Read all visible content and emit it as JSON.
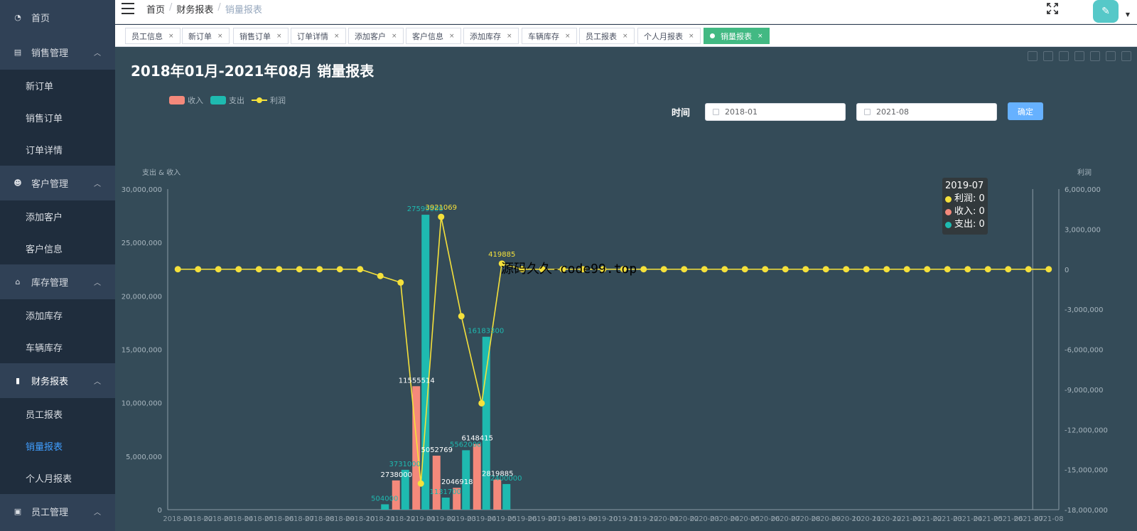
{
  "sidebar": {
    "home": "首页",
    "groups": [
      {
        "label": "销售管理",
        "items": [
          "新订单",
          "销售订单",
          "订单详情"
        ]
      },
      {
        "label": "客户管理",
        "items": [
          "添加客户",
          "客户信息"
        ]
      },
      {
        "label": "库存管理",
        "items": [
          "添加库存",
          "车辆库存"
        ]
      },
      {
        "label": "财务报表",
        "items": [
          "员工报表",
          "销量报表",
          "个人月报表"
        ],
        "active_item": "销量报表"
      },
      {
        "label": "员工管理",
        "items": []
      }
    ]
  },
  "header": {
    "breadcrumb": [
      "首页",
      "财务报表",
      "销量报表"
    ]
  },
  "tags": [
    {
      "label": "员工信息"
    },
    {
      "label": "新订单"
    },
    {
      "label": "销售订单"
    },
    {
      "label": "订单详情"
    },
    {
      "label": "添加客户"
    },
    {
      "label": "客户信息"
    },
    {
      "label": "添加库存"
    },
    {
      "label": "车辆库存"
    },
    {
      "label": "员工报表"
    },
    {
      "label": "个人月报表"
    },
    {
      "label": "销量报表",
      "active": true
    }
  ],
  "tag_close": "×",
  "page": {
    "title": "2018年01月-2021年08月 销量报表",
    "filter_label": "时间",
    "start_date": "2018-01",
    "end_date": "2021-08",
    "confirm_label": "确定",
    "watermark": "源码久久-code99.top"
  },
  "tooltip": {
    "title": "2019-07",
    "rows": [
      {
        "label": "利润: 0",
        "color": "#f5e13b"
      },
      {
        "label": "收入: 0",
        "color": "#f4897b"
      },
      {
        "label": "支出: 0",
        "color": "#1ebab0"
      }
    ]
  },
  "chart_data": {
    "type": "bar",
    "legend": [
      "收入",
      "支出",
      "利润"
    ],
    "legend_position": "top-left",
    "colors": {
      "收入": "#f4897b",
      "支出": "#1ebab0",
      "利润": "#f5e13b"
    },
    "ylabel_left": "支出 & 收入",
    "ylabel_right": "利润",
    "ylim_left": [
      0,
      30000000
    ],
    "ylim_right": [
      -18000000,
      6000000
    ],
    "yticks_left": [
      "0",
      "5,000,000",
      "10,000,000",
      "15,000,000",
      "20,000,000",
      "25,000,000",
      "30,000,000"
    ],
    "yticks_right": [
      "-18,000,000",
      "-15,000,000",
      "-12,000,000",
      "-9,000,000",
      "-6,000,000",
      "-3,000,000",
      "0",
      "3,000,000",
      "6,000,000"
    ],
    "categories": [
      "2018-01",
      "2018-02",
      "2018-03",
      "2018-04",
      "2018-05",
      "2018-06",
      "2018-07",
      "2018-08",
      "2018-09",
      "2018-10",
      "2018-11",
      "2018-12",
      "2019-01",
      "2019-02",
      "2019-03",
      "2019-04",
      "2019-05",
      "2019-06",
      "2019-07",
      "2019-08",
      "2019-09",
      "2019-10",
      "2019-11",
      "2019-12",
      "2020-01",
      "2020-02",
      "2020-03",
      "2020-04",
      "2020-05",
      "2020-06",
      "2020-07",
      "2020-08",
      "2020-09",
      "2020-10",
      "2020-11",
      "2020-12",
      "2021-01",
      "2021-02",
      "2021-03",
      "2021-04",
      "2021-05",
      "2021-06",
      "2021-07",
      "2021-08"
    ],
    "series": [
      {
        "name": "收入",
        "type": "bar",
        "values": [
          0,
          0,
          0,
          0,
          0,
          0,
          0,
          0,
          0,
          0,
          0,
          2738000,
          11555514,
          5052769,
          2046918,
          6148415,
          2819885,
          0,
          0,
          0,
          0,
          0,
          0,
          0,
          0,
          0,
          0,
          0,
          0,
          0,
          0,
          0,
          0,
          0,
          0,
          0,
          0,
          0,
          0,
          0,
          0,
          0,
          0,
          0
        ]
      },
      {
        "name": "支出",
        "type": "bar",
        "values": [
          0,
          0,
          0,
          0,
          0,
          0,
          0,
          0,
          0,
          0,
          504000,
          3731000,
          27599000,
          1131700,
          5562000,
          16183300,
          2400000,
          0,
          0,
          0,
          0,
          0,
          0,
          0,
          0,
          0,
          0,
          0,
          0,
          0,
          0,
          0,
          0,
          0,
          0,
          0,
          0,
          0,
          0,
          0,
          0,
          0,
          0,
          0
        ]
      },
      {
        "name": "利润",
        "type": "line",
        "values": [
          0,
          0,
          0,
          0,
          0,
          0,
          0,
          0,
          0,
          0,
          -504000,
          -993000,
          -16043486,
          3921069,
          -3515082,
          -10034885,
          419885,
          0,
          0,
          0,
          0,
          0,
          0,
          0,
          0,
          0,
          0,
          0,
          0,
          0,
          0,
          0,
          0,
          0,
          0,
          0,
          0,
          0,
          0,
          0,
          0,
          0,
          0,
          0
        ]
      }
    ],
    "bar_labels": [
      {
        "series": "支出",
        "index": 10,
        "text": "504000"
      },
      {
        "series": "收入",
        "index": 11,
        "text": "2738000"
      },
      {
        "series": "支出",
        "index": 11,
        "text": "3731000"
      },
      {
        "series": "收入",
        "index": 12,
        "text": "11555514"
      },
      {
        "series": "支出",
        "index": 12,
        "text": "27599000"
      },
      {
        "series": "收入",
        "index": 13,
        "text": "5052769"
      },
      {
        "series": "支出",
        "index": 13,
        "text": "1131700"
      },
      {
        "series": "收入",
        "index": 14,
        "text": "2046918"
      },
      {
        "series": "支出",
        "index": 14,
        "text": "5562000"
      },
      {
        "series": "收入",
        "index": 15,
        "text": "6148415"
      },
      {
        "series": "支出",
        "index": 15,
        "text": "16183300"
      },
      {
        "series": "收入",
        "index": 16,
        "text": "2819885"
      },
      {
        "series": "支出",
        "index": 16,
        "text": "2400000"
      }
    ],
    "line_labels": [
      {
        "index": 13,
        "text": "3921069"
      },
      {
        "index": 16,
        "text": "419885"
      }
    ]
  }
}
